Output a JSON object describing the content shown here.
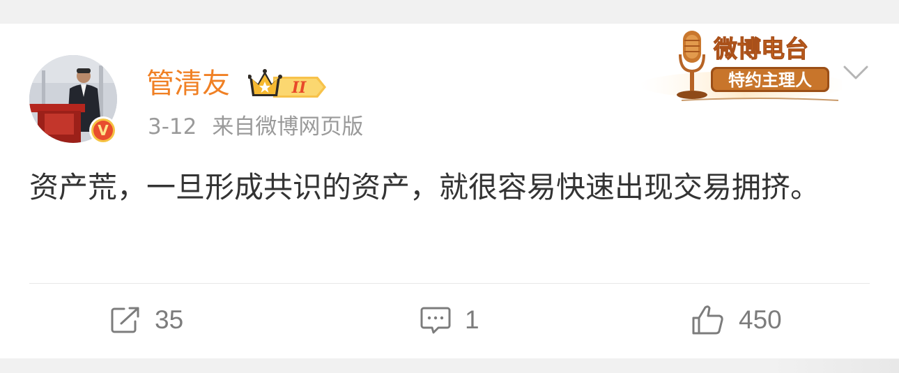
{
  "user": {
    "name": "管清友",
    "rank_badge": "II",
    "verified_mark": "V"
  },
  "post": {
    "date": "3-12",
    "source": "来自微博网页版",
    "text": "资产荒，一旦形成共识的资产，就很容易快速出现交易拥挤。"
  },
  "radio_badge": {
    "title": "微博电台",
    "subtitle": "特约主理人"
  },
  "actions": {
    "repost_count": "35",
    "comment_count": "1",
    "like_count": "450"
  },
  "icons": [
    "repost-icon",
    "comment-icon",
    "like-icon",
    "chevron-down-icon",
    "microphone-icon",
    "crown-icon",
    "verified-icon"
  ],
  "colors": {
    "username": "#f08024",
    "text": "#333333",
    "meta": "#9a9a9a",
    "action": "#7c7c7c",
    "badge_gold": "#f6c343",
    "badge_red": "#e84d2e"
  }
}
